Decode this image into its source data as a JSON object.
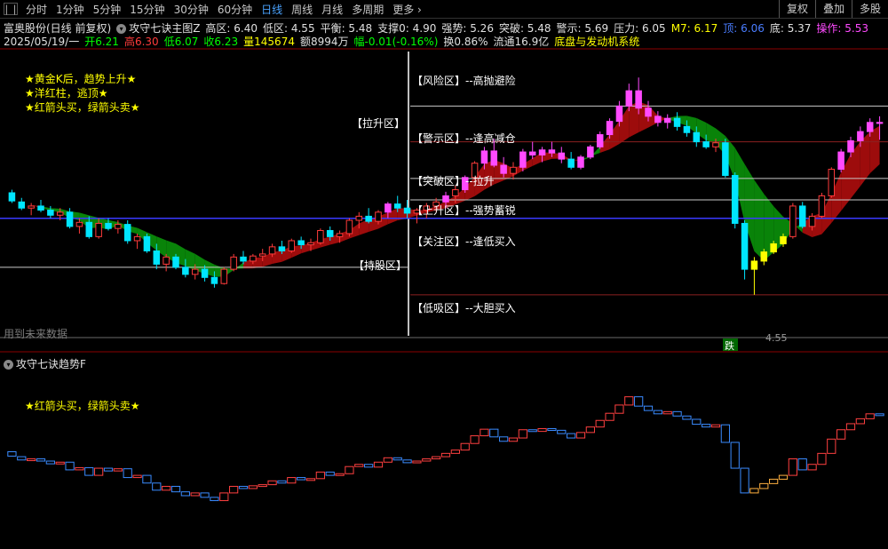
{
  "toolbar": {
    "periods": [
      "分时",
      "1分钟",
      "5分钟",
      "15分钟",
      "30分钟",
      "60分钟",
      "日线",
      "周线",
      "月线",
      "多周期",
      "更多"
    ],
    "active_period": "日线",
    "more_arrow": "›",
    "buttons": [
      "复权",
      "叠加",
      "多股"
    ]
  },
  "header": {
    "stock": "富奥股份(日线 前复权)",
    "indicator_name": "攻守七诀主图Z",
    "high_zone": "高区: 6.40",
    "low_zone": "低区: 4.55",
    "balance": "平衡: 5.48",
    "support": "支撑0: 4.90",
    "strong": "强势: 5.26",
    "breakout": "突破: 5.48",
    "warning": "警示: 5.69",
    "pressure": "压力: 6.05",
    "m7": "M7: 6.17",
    "top_label": "顶: 6.06",
    "bottom_label": "底: 5.37",
    "operation": "操作: 5.53",
    "date": "2025/05/19/一",
    "open": "开6.21",
    "high": "高6.30",
    "low": "低6.07",
    "close": "收6.23",
    "volume": "量145674",
    "amount": "额8994万",
    "change": "幅-0.01(-0.16%)",
    "turnover": "换0.86%",
    "float": "流通16.9亿",
    "concept": "底盘与发动机系统"
  },
  "colors": {
    "up": "#ff3b3b",
    "down": "#00e5ff",
    "magenta": "#ff4aff",
    "yellow": "#ffff00",
    "green_band": "#0a8a0a",
    "red_band": "#a50d0d",
    "blue_line": "#3a3aff"
  },
  "annotations": {
    "left_notes": [
      "★黄金K后，趋势上升★",
      "★洋红柱，逃顶★",
      "★红箭头买，绿箭头卖★"
    ],
    "zones": [
      "【风险区】--高抛避险",
      "【警示区】--逢高减仓",
      "【突破区】--拉升",
      "【上升区】--强势蓄锐",
      "【关注区】--逢低买入",
      "【低吸区】--大胆买入"
    ],
    "pull_zone": "【拉升区】",
    "hold_zone": "【持股区】",
    "future_data": "用到未来数据",
    "low_marker": "4.55",
    "fall_tag": "跌"
  },
  "sub_panel": {
    "title": "攻守七诀趋势F",
    "note": "★红箭头买，绿箭头卖★"
  },
  "chart_data": {
    "type": "candlestick",
    "main": {
      "ylim": [
        4.2,
        6.9
      ],
      "ohlc": [
        [
          5.55,
          5.58,
          5.45,
          5.47
        ],
        [
          5.46,
          5.5,
          5.38,
          5.4
        ],
        [
          5.4,
          5.45,
          5.33,
          5.42
        ],
        [
          5.42,
          5.48,
          5.36,
          5.38
        ],
        [
          5.38,
          5.42,
          5.3,
          5.33
        ],
        [
          5.33,
          5.4,
          5.28,
          5.36
        ],
        [
          5.36,
          5.4,
          5.2,
          5.22
        ],
        [
          5.22,
          5.3,
          5.15,
          5.26
        ],
        [
          5.26,
          5.32,
          5.1,
          5.12
        ],
        [
          5.12,
          5.3,
          5.1,
          5.25
        ],
        [
          5.25,
          5.3,
          5.18,
          5.2
        ],
        [
          5.2,
          5.28,
          5.15,
          5.24
        ],
        [
          5.24,
          5.28,
          5.05,
          5.08
        ],
        [
          5.08,
          5.15,
          5.0,
          5.12
        ],
        [
          5.12,
          5.15,
          4.96,
          4.98
        ],
        [
          4.98,
          5.05,
          4.8,
          4.85
        ],
        [
          4.85,
          4.95,
          4.78,
          4.92
        ],
        [
          4.92,
          4.95,
          4.8,
          4.82
        ],
        [
          4.82,
          4.9,
          4.72,
          4.75
        ],
        [
          4.75,
          4.85,
          4.7,
          4.8
        ],
        [
          4.8,
          4.84,
          4.68,
          4.72
        ],
        [
          4.72,
          4.78,
          4.62,
          4.66
        ],
        [
          4.66,
          4.82,
          4.65,
          4.8
        ],
        [
          4.8,
          4.95,
          4.78,
          4.92
        ],
        [
          4.92,
          4.98,
          4.85,
          4.88
        ],
        [
          4.88,
          4.95,
          4.85,
          4.93
        ],
        [
          4.93,
          5.0,
          4.88,
          4.95
        ],
        [
          4.95,
          5.05,
          4.92,
          5.02
        ],
        [
          5.02,
          5.08,
          4.95,
          4.98
        ],
        [
          4.98,
          5.1,
          4.96,
          5.08
        ],
        [
          5.08,
          5.12,
          5.0,
          5.04
        ],
        [
          5.04,
          5.1,
          4.98,
          5.06
        ],
        [
          5.06,
          5.2,
          5.04,
          5.18
        ],
        [
          5.18,
          5.22,
          5.08,
          5.12
        ],
        [
          5.12,
          5.18,
          5.06,
          5.15
        ],
        [
          5.15,
          5.3,
          5.12,
          5.28
        ],
        [
          5.28,
          5.36,
          5.2,
          5.32
        ],
        [
          5.32,
          5.4,
          5.25,
          5.27
        ],
        [
          5.27,
          5.38,
          5.24,
          5.36
        ],
        [
          5.36,
          5.46,
          5.3,
          5.44
        ],
        [
          5.44,
          5.52,
          5.36,
          5.4
        ],
        [
          5.4,
          5.48,
          5.3,
          5.35
        ],
        [
          5.35,
          5.4,
          5.25,
          5.38
        ],
        [
          5.38,
          5.45,
          5.3,
          5.42
        ],
        [
          5.42,
          5.5,
          5.36,
          5.46
        ],
        [
          5.46,
          5.56,
          5.4,
          5.52
        ],
        [
          5.52,
          5.62,
          5.45,
          5.58
        ],
        [
          5.58,
          5.72,
          5.55,
          5.7
        ],
        [
          5.7,
          5.86,
          5.68,
          5.84
        ],
        [
          5.84,
          6.0,
          5.78,
          5.96
        ],
        [
          5.96,
          6.08,
          5.8,
          5.82
        ],
        [
          5.82,
          5.9,
          5.7,
          5.74
        ],
        [
          5.74,
          5.85,
          5.68,
          5.8
        ],
        [
          5.8,
          5.98,
          5.76,
          5.95
        ],
        [
          5.95,
          6.05,
          5.88,
          5.92
        ],
        [
          5.92,
          6.0,
          5.85,
          5.97
        ],
        [
          5.97,
          6.05,
          5.9,
          5.94
        ],
        [
          5.94,
          6.0,
          5.84,
          5.88
        ],
        [
          5.88,
          5.95,
          5.78,
          5.8
        ],
        [
          5.8,
          5.92,
          5.78,
          5.9
        ],
        [
          5.9,
          6.02,
          5.88,
          6.0
        ],
        [
          6.0,
          6.15,
          5.98,
          6.12
        ],
        [
          6.12,
          6.28,
          6.08,
          6.25
        ],
        [
          6.25,
          6.45,
          6.2,
          6.4
        ],
        [
          6.4,
          6.62,
          6.35,
          6.55
        ],
        [
          6.55,
          6.68,
          6.32,
          6.38
        ],
        [
          6.38,
          6.45,
          6.25,
          6.3
        ],
        [
          6.3,
          6.35,
          6.2,
          6.24
        ],
        [
          6.24,
          6.32,
          6.18,
          6.28
        ],
        [
          6.28,
          6.34,
          6.16,
          6.2
        ],
        [
          6.2,
          6.26,
          6.1,
          6.14
        ],
        [
          6.14,
          6.2,
          6.0,
          6.05
        ],
        [
          6.05,
          6.12,
          5.98,
          6.0
        ],
        [
          6.0,
          6.08,
          5.95,
          6.04
        ],
        [
          6.04,
          6.08,
          5.7,
          5.72
        ],
        [
          5.72,
          5.75,
          5.2,
          5.25
        ],
        [
          5.25,
          5.28,
          4.7,
          4.8
        ],
        [
          4.8,
          4.92,
          4.55,
          4.88
        ],
        [
          4.88,
          5.0,
          4.84,
          4.97
        ],
        [
          4.97,
          5.08,
          4.95,
          5.05
        ],
        [
          5.05,
          5.15,
          5.02,
          5.12
        ],
        [
          5.12,
          5.45,
          5.1,
          5.42
        ],
        [
          5.42,
          5.46,
          5.2,
          5.22
        ],
        [
          5.22,
          5.35,
          5.18,
          5.32
        ],
        [
          5.32,
          5.55,
          5.3,
          5.52
        ],
        [
          5.52,
          5.8,
          5.5,
          5.78
        ],
        [
          5.78,
          5.98,
          5.75,
          5.95
        ],
        [
          5.95,
          6.1,
          5.9,
          6.06
        ],
        [
          6.06,
          6.2,
          6.0,
          6.15
        ],
        [
          6.15,
          6.28,
          6.1,
          6.24
        ],
        [
          6.24,
          6.3,
          6.07,
          6.23
        ]
      ],
      "magenta_bars": [
        39,
        45,
        47,
        49,
        50,
        51,
        53,
        54,
        55,
        56,
        57,
        59,
        60,
        61,
        62,
        63,
        64,
        65,
        66,
        67,
        68,
        86,
        87,
        88,
        89,
        90,
        91
      ],
      "yellow_bars": [
        77,
        78,
        79,
        80
      ],
      "lines": {
        "high_zone": 6.4,
        "warning": 5.69,
        "breakout": 5.48,
        "pressure": 6.05,
        "low_zone": 4.55
      }
    },
    "sub": {
      "ylim": [
        4.2,
        6.9
      ],
      "values_source": "close"
    }
  }
}
